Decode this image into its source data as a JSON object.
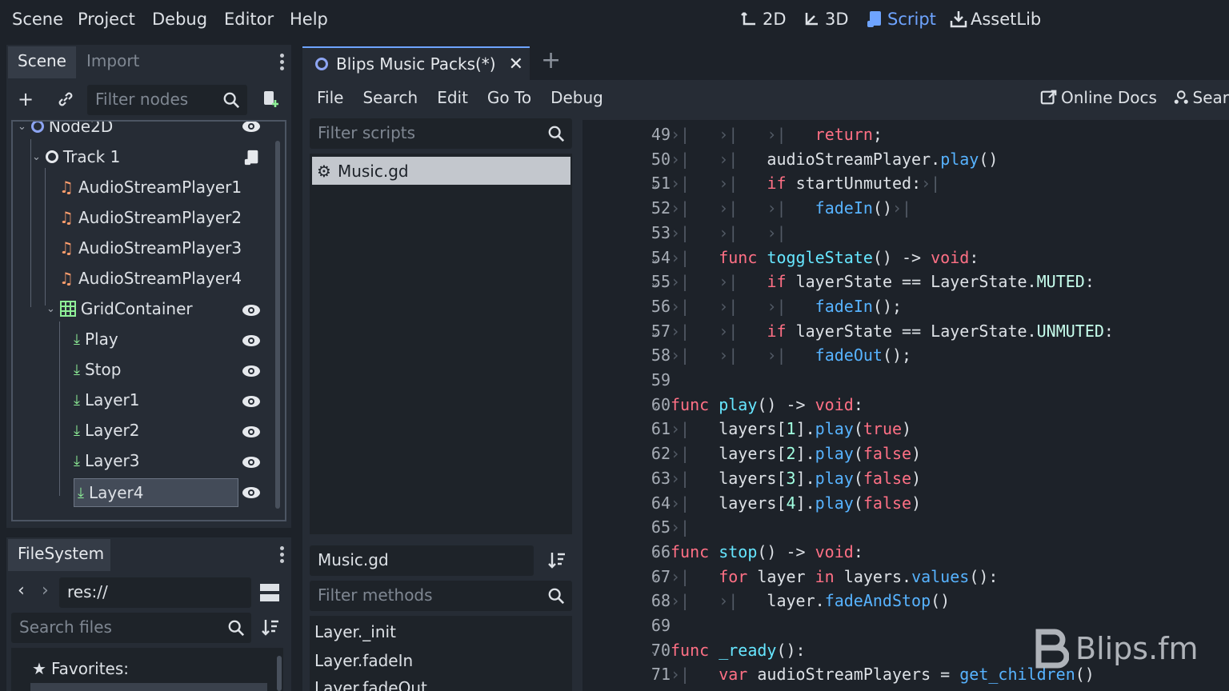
{
  "menu": [
    "Scene",
    "Project",
    "Debug",
    "Editor",
    "Help"
  ],
  "workspaces": [
    {
      "label": "2D",
      "icon": "2d-icon"
    },
    {
      "label": "3D",
      "icon": "3d-icon"
    },
    {
      "label": "Script",
      "icon": "script-icon",
      "active": true
    },
    {
      "label": "AssetLib",
      "icon": "assetlib-icon"
    }
  ],
  "scene_dock": {
    "tabs": [
      "Scene",
      "Import"
    ],
    "filter_placeholder": "Filter nodes",
    "nodes": [
      {
        "label": "Node2D",
        "icon": "node2d-icon",
        "depth": 0,
        "eye": true,
        "caret": true
      },
      {
        "label": "Track 1",
        "icon": "node2d-icon",
        "depth": 1,
        "script": true,
        "caret": true
      },
      {
        "label": "AudioStreamPlayer1",
        "icon": "audio-icon",
        "depth": 2
      },
      {
        "label": "AudioStreamPlayer2",
        "icon": "audio-icon",
        "depth": 2
      },
      {
        "label": "AudioStreamPlayer3",
        "icon": "audio-icon",
        "depth": 2
      },
      {
        "label": "AudioStreamPlayer4",
        "icon": "audio-icon",
        "depth": 2
      },
      {
        "label": "GridContainer",
        "icon": "grid-icon",
        "depth": 2,
        "eye": true,
        "caret": true
      },
      {
        "label": "Play",
        "icon": "button-icon",
        "depth": 3,
        "eye": true
      },
      {
        "label": "Stop",
        "icon": "button-icon",
        "depth": 3,
        "eye": true
      },
      {
        "label": "Layer1",
        "icon": "button-icon",
        "depth": 3,
        "eye": true
      },
      {
        "label": "Layer2",
        "icon": "button-icon",
        "depth": 3,
        "eye": true
      },
      {
        "label": "Layer3",
        "icon": "button-icon",
        "depth": 3,
        "eye": true
      },
      {
        "label": "Layer4",
        "icon": "button-icon",
        "depth": 3,
        "eye": true,
        "selected": true
      }
    ]
  },
  "filesystem": {
    "tab": "FileSystem",
    "path": "res://",
    "search_placeholder": "Search files",
    "favorites": "Favorites:"
  },
  "editor_tab": {
    "label": "Blips Music Packs(*)"
  },
  "script_menu": [
    "File",
    "Search",
    "Edit",
    "Go To",
    "Debug"
  ],
  "online_docs": "Online Docs",
  "search_help": "Sear",
  "scripts": {
    "filter_placeholder": "Filter scripts",
    "items": [
      "Music.gd"
    ],
    "current": "Music.gd",
    "methods_placeholder": "Filter methods",
    "methods": [
      "Layer._init",
      "Layer.fadeIn",
      "Layer.fadeOut"
    ]
  },
  "code_lines": [
    {
      "n": "49",
      "t": 3,
      "h": "<span class='kw'>return</span>;"
    },
    {
      "n": "50",
      "t": 2,
      "h": "audioStreamPlayer.<span class='fn'>play</span>()"
    },
    {
      "n": "51",
      "t": 2,
      "fold": true,
      "h": "<span class='kw'>if</span> startUnmuted:<span class='tabmark'>›|</span>"
    },
    {
      "n": "52",
      "t": 3,
      "h": "<span class='fn'>fadeIn</span>()<span class='tabmark'>›|</span>"
    },
    {
      "n": "53",
      "t": 3,
      "h": ""
    },
    {
      "n": "54",
      "t": 1,
      "fold": true,
      "h": "<span class='kw'>func</span> <span class='fnd'>toggleState</span>() -&gt; <span class='kw'>void</span>:"
    },
    {
      "n": "55",
      "t": 2,
      "fold": true,
      "h": "<span class='kw'>if</span> layerState == LayerState.<span class='cls'>MUTED</span>:"
    },
    {
      "n": "56",
      "t": 3,
      "h": "<span class='fn'>fadeIn</span>();"
    },
    {
      "n": "57",
      "t": 2,
      "fold": true,
      "h": "<span class='kw'>if</span> layerState == LayerState.<span class='cls'>UNMUTED</span>:"
    },
    {
      "n": "58",
      "t": 3,
      "h": "<span class='fn'>fadeOut</span>();"
    },
    {
      "n": "59",
      "t": 0,
      "h": ""
    },
    {
      "n": "60",
      "t": 0,
      "fold": true,
      "h": "<span class='kw'>func</span> <span class='fnd'>play</span>() -&gt; <span class='kw'>void</span>:"
    },
    {
      "n": "61",
      "t": 1,
      "h": "layers[<span class='num'>1</span>].<span class='fn'>play</span>(<span class='kw'>true</span>)"
    },
    {
      "n": "62",
      "t": 1,
      "h": "layers[<span class='num'>2</span>].<span class='fn'>play</span>(<span class='kw'>false</span>)"
    },
    {
      "n": "63",
      "t": 1,
      "h": "layers[<span class='num'>3</span>].<span class='fn'>play</span>(<span class='kw'>false</span>)"
    },
    {
      "n": "64",
      "t": 1,
      "h": "layers[<span class='num'>4</span>].<span class='fn'>play</span>(<span class='kw'>false</span>)"
    },
    {
      "n": "65",
      "t": 1,
      "h": ""
    },
    {
      "n": "66",
      "t": 0,
      "fold": true,
      "h": "<span class='kw'>func</span> <span class='fnd'>stop</span>() -&gt; <span class='kw'>void</span>:"
    },
    {
      "n": "67",
      "t": 1,
      "fold": true,
      "h": "<span class='kw'>for</span> layer <span class='kw'>in</span> layers.<span class='fn'>values</span>():"
    },
    {
      "n": "68",
      "t": 2,
      "h": "layer.<span class='fn'>fadeAndStop</span>()"
    },
    {
      "n": "69",
      "t": 0,
      "h": ""
    },
    {
      "n": "70",
      "t": 0,
      "fold": true,
      "h": "<span class='kw'>func</span> <span class='fnd'>_ready</span>():"
    },
    {
      "n": "71",
      "t": 1,
      "h": "<span class='kw'>var</span> audioStreamPlayers = <span class='fn'>get_children</span>()"
    }
  ],
  "watermark": "Blips.fm",
  "colors": {
    "accent": "#6ea4ff",
    "keyword": "#ff7085",
    "function": "#57b3ff"
  }
}
